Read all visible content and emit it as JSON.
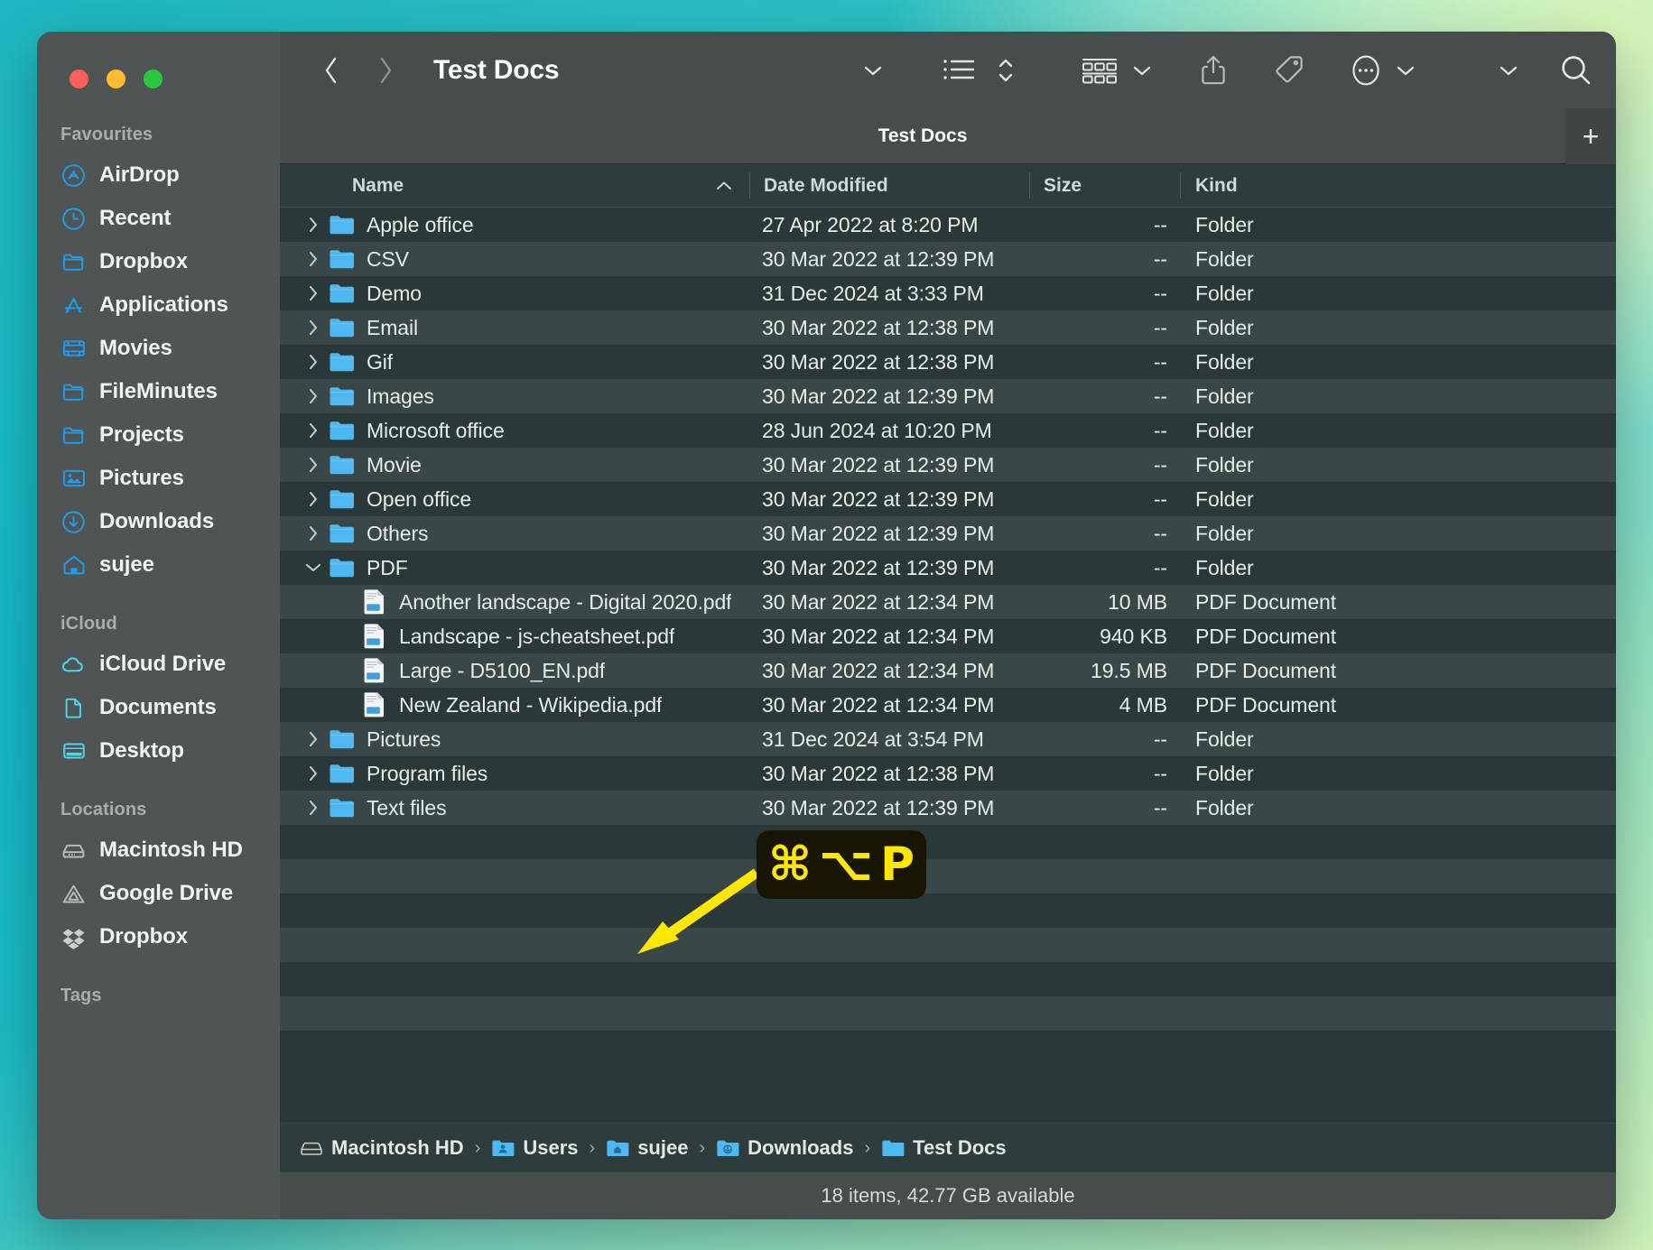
{
  "window": {
    "traffic_lights": [
      {
        "name": "close",
        "color": "#ff5f57"
      },
      {
        "name": "minimize",
        "color": "#febc2e"
      },
      {
        "name": "maximize",
        "color": "#28c840"
      }
    ]
  },
  "sidebar": {
    "sections": [
      {
        "title": "Favourites",
        "items": [
          {
            "label": "AirDrop",
            "icon": "airdrop-icon"
          },
          {
            "label": "Recent",
            "icon": "clock-icon"
          },
          {
            "label": "Dropbox",
            "icon": "folder-icon"
          },
          {
            "label": "Applications",
            "icon": "applications-icon"
          },
          {
            "label": "Movies",
            "icon": "film-icon"
          },
          {
            "label": "FileMinutes",
            "icon": "folder-icon"
          },
          {
            "label": "Projects",
            "icon": "folder-icon"
          },
          {
            "label": "Pictures",
            "icon": "photo-icon"
          },
          {
            "label": "Downloads",
            "icon": "download-circle-icon"
          },
          {
            "label": "sujee",
            "icon": "home-icon"
          }
        ]
      },
      {
        "title": "iCloud",
        "items": [
          {
            "label": "iCloud Drive",
            "icon": "cloud-icon"
          },
          {
            "label": "Documents",
            "icon": "document-icon"
          },
          {
            "label": "Desktop",
            "icon": "desktop-icon"
          }
        ]
      },
      {
        "title": "Locations",
        "items": [
          {
            "label": "Macintosh HD",
            "icon": "harddisk-icon"
          },
          {
            "label": "Google Drive",
            "icon": "google-drive-icon"
          },
          {
            "label": "Dropbox",
            "icon": "dropbox-icon"
          }
        ]
      },
      {
        "title": "Tags",
        "items": []
      }
    ]
  },
  "toolbar": {
    "back_icon": "chevron-left-icon",
    "forward_icon": "chevron-right-icon",
    "title": "Test Docs",
    "title_dropdown_icon": "chevron-down-icon",
    "view_list_icon": "list-view-icon",
    "sort_icon": "sort-updown-icon",
    "group_icon": "group-view-icon",
    "group_dropdown_icon": "chevron-down-icon",
    "share_icon": "share-icon",
    "tag_icon": "tag-icon",
    "more_icon": "ellipsis-circle-icon",
    "more_dropdown_icon": "chevron-down-icon",
    "extra_dropdown_icon": "chevron-down-icon",
    "search_icon": "search-icon"
  },
  "tabbar": {
    "active_tab": "Test Docs",
    "new_tab_label": "+"
  },
  "columns": {
    "name": "Name",
    "date_modified": "Date Modified",
    "size": "Size",
    "kind": "Kind",
    "sort_indicator": "chevron-up-icon"
  },
  "files": [
    {
      "name": "Apple office",
      "date": "27 Apr 2022 at 8:20 PM",
      "size": "--",
      "kind": "Folder",
      "type": "folder",
      "expanded": false,
      "child": false
    },
    {
      "name": "CSV",
      "date": "30 Mar 2022 at 12:39 PM",
      "size": "--",
      "kind": "Folder",
      "type": "folder",
      "expanded": false,
      "child": false
    },
    {
      "name": "Demo",
      "date": "31 Dec 2024 at 3:33 PM",
      "size": "--",
      "kind": "Folder",
      "type": "folder",
      "expanded": false,
      "child": false
    },
    {
      "name": "Email",
      "date": "30 Mar 2022 at 12:38 PM",
      "size": "--",
      "kind": "Folder",
      "type": "folder",
      "expanded": false,
      "child": false
    },
    {
      "name": "Gif",
      "date": "30 Mar 2022 at 12:38 PM",
      "size": "--",
      "kind": "Folder",
      "type": "folder",
      "expanded": false,
      "child": false
    },
    {
      "name": "Images",
      "date": "30 Mar 2022 at 12:39 PM",
      "size": "--",
      "kind": "Folder",
      "type": "folder",
      "expanded": false,
      "child": false
    },
    {
      "name": "Microsoft office",
      "date": "28 Jun 2024 at 10:20 PM",
      "size": "--",
      "kind": "Folder",
      "type": "folder",
      "expanded": false,
      "child": false
    },
    {
      "name": "Movie",
      "date": "30 Mar 2022 at 12:39 PM",
      "size": "--",
      "kind": "Folder",
      "type": "folder",
      "expanded": false,
      "child": false
    },
    {
      "name": "Open office",
      "date": "30 Mar 2022 at 12:39 PM",
      "size": "--",
      "kind": "Folder",
      "type": "folder",
      "expanded": false,
      "child": false
    },
    {
      "name": "Others",
      "date": "30 Mar 2022 at 12:39 PM",
      "size": "--",
      "kind": "Folder",
      "type": "folder",
      "expanded": false,
      "child": false
    },
    {
      "name": "PDF",
      "date": "30 Mar 2022 at 12:39 PM",
      "size": "--",
      "kind": "Folder",
      "type": "folder",
      "expanded": true,
      "child": false
    },
    {
      "name": "Another landscape - Digital 2020.pdf",
      "date": "30 Mar 2022 at 12:34 PM",
      "size": "10 MB",
      "kind": "PDF Document",
      "type": "pdf",
      "expanded": false,
      "child": true
    },
    {
      "name": "Landscape - js-cheatsheet.pdf",
      "date": "30 Mar 2022 at 12:34 PM",
      "size": "940 KB",
      "kind": "PDF Document",
      "type": "pdf",
      "expanded": false,
      "child": true
    },
    {
      "name": "Large - D5100_EN.pdf",
      "date": "30 Mar 2022 at 12:34 PM",
      "size": "19.5 MB",
      "kind": "PDF Document",
      "type": "pdf",
      "expanded": false,
      "child": true
    },
    {
      "name": "New Zealand - Wikipedia.pdf",
      "date": "30 Mar 2022 at 12:34 PM",
      "size": "4 MB",
      "kind": "PDF Document",
      "type": "pdf",
      "expanded": false,
      "child": true
    },
    {
      "name": "Pictures",
      "date": "31 Dec 2024 at 3:54 PM",
      "size": "--",
      "kind": "Folder",
      "type": "folder",
      "expanded": false,
      "child": false
    },
    {
      "name": "Program files",
      "date": "30 Mar 2022 at 12:38 PM",
      "size": "--",
      "kind": "Folder",
      "type": "folder",
      "expanded": false,
      "child": false
    },
    {
      "name": "Text files",
      "date": "30 Mar 2022 at 12:39 PM",
      "size": "--",
      "kind": "Folder",
      "type": "folder",
      "expanded": false,
      "child": false
    }
  ],
  "pathbar": {
    "crumbs": [
      {
        "label": "Macintosh HD",
        "icon": "harddisk-icon"
      },
      {
        "label": "Users",
        "icon": "users-folder-icon"
      },
      {
        "label": "sujee",
        "icon": "home-folder-icon"
      },
      {
        "label": "Downloads",
        "icon": "downloads-folder-icon"
      },
      {
        "label": "Test Docs",
        "icon": "folder-icon"
      }
    ],
    "separator": "›"
  },
  "statusbar": {
    "text": "18 items, 42.77 GB available"
  },
  "annotation": {
    "shortcut_command": "⌘",
    "shortcut_option": "⌥",
    "shortcut_key": "P",
    "badge_color": "#ffe700",
    "arrow_color": "#ffe700"
  }
}
